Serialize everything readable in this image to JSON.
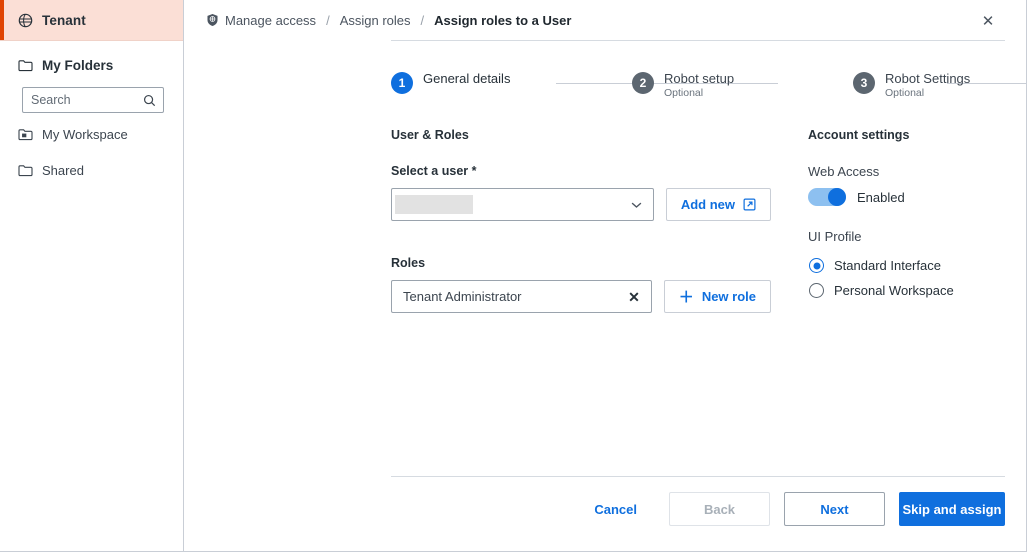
{
  "sidebar": {
    "tenant": {
      "label": "Tenant",
      "icon": "globe-icon"
    },
    "my_folders": {
      "label": "My Folders",
      "icon": "folder-icon"
    },
    "search": {
      "value": "",
      "placeholder": "Search",
      "icon": "search-icon"
    },
    "items": [
      {
        "label": "My Workspace",
        "icon": "workspace-folder-icon"
      },
      {
        "label": "Shared",
        "icon": "folder-icon"
      }
    ]
  },
  "breadcrumb": {
    "shield_icon": "shield-icon",
    "item1": "Manage access",
    "sep1": "/",
    "item2": "Assign roles",
    "sep2": "/",
    "current": "Assign roles to a User"
  },
  "close_label": "✕",
  "stepper": [
    {
      "number": "1",
      "title": "General details",
      "subtitle": "",
      "state": "active"
    },
    {
      "number": "2",
      "title": "Robot setup",
      "subtitle": "Optional",
      "state": "inactive"
    },
    {
      "number": "3",
      "title": "Robot Settings",
      "subtitle": "Optional",
      "state": "inactive"
    }
  ],
  "user_roles": {
    "section_title": "User & Roles",
    "select_user_label": "Select a user *",
    "select_user_value": "",
    "add_new_label": "Add new",
    "add_new_icon": "external-link-icon",
    "roles_label": "Roles",
    "role_value": "Tenant Administrator",
    "role_remove_icon": "✕",
    "new_role_label": "New role",
    "new_role_icon": "＋"
  },
  "account_settings": {
    "section_title": "Account settings",
    "web_access_label": "Web Access",
    "web_access_state": "Enabled",
    "web_access_enabled": true,
    "ui_profile_label": "UI Profile",
    "options": [
      {
        "label": "Standard Interface",
        "selected": true
      },
      {
        "label": "Personal Workspace",
        "selected": false
      }
    ]
  },
  "footer": {
    "cancel": "Cancel",
    "back": "Back",
    "next": "Next",
    "skip_assign": "Skip and assign"
  },
  "colors": {
    "accent_blue": "#0f6fde",
    "tenant_highlight": "#fbdfd6",
    "tenant_bar": "#e04403",
    "step_inactive": "#5c6670"
  }
}
